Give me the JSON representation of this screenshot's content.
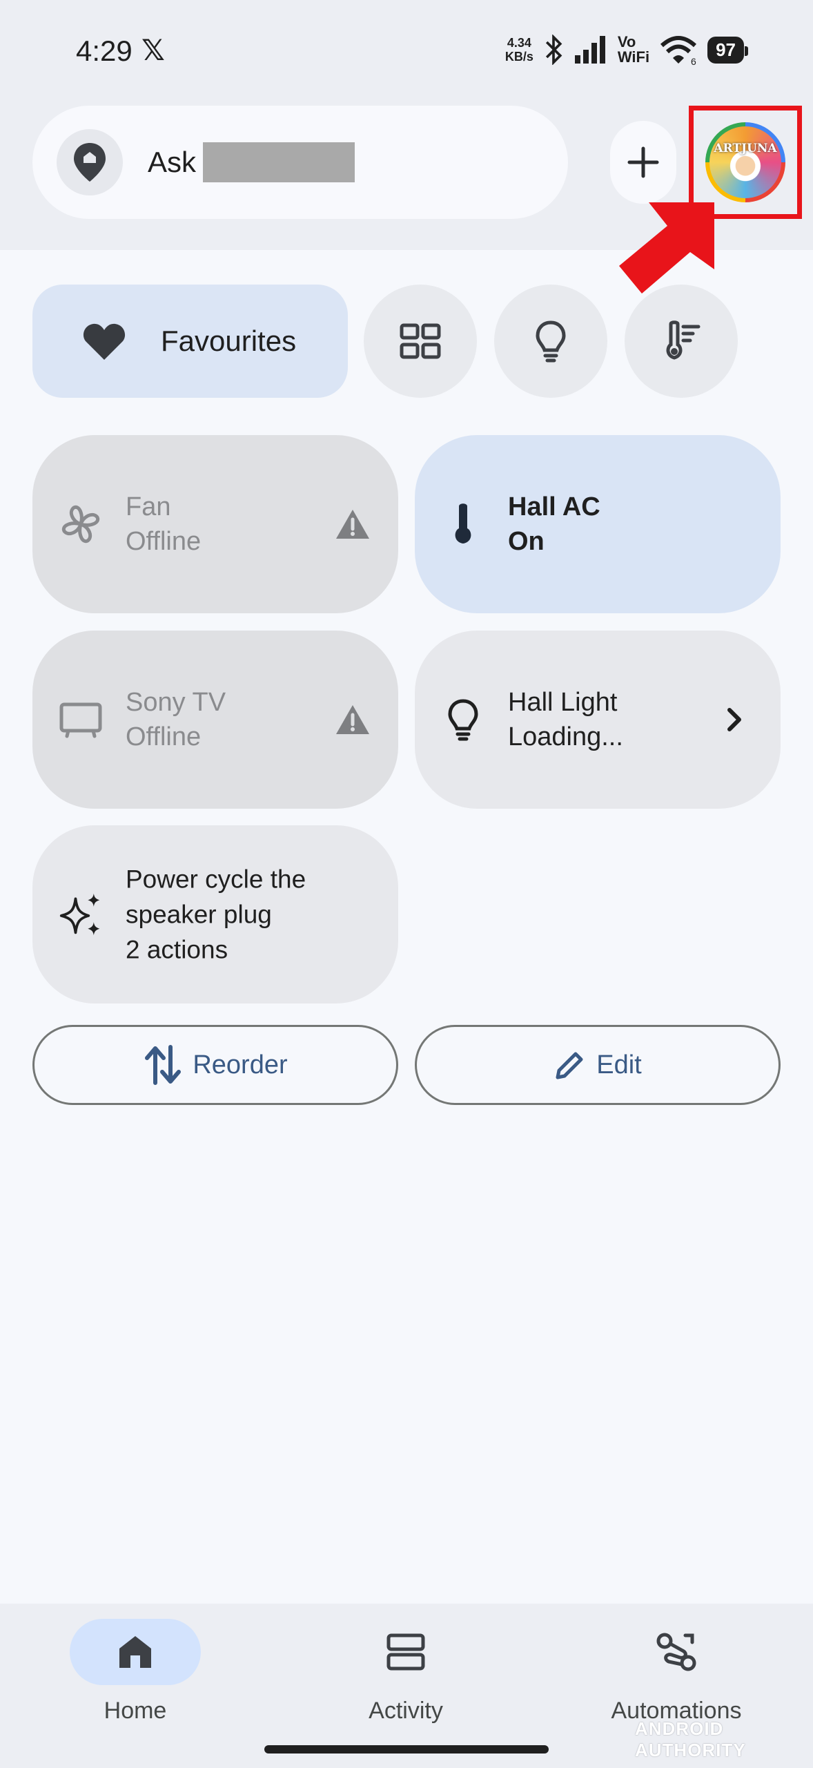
{
  "status_bar": {
    "time": "4:29",
    "x_app": "𝕏",
    "net_speed_value": "4.34",
    "net_speed_unit": "KB/s",
    "vo": "Vo",
    "wifi_label": "WiFi",
    "wifi_sub": "6",
    "battery": "97"
  },
  "search": {
    "ask_label": "Ask"
  },
  "avatar": {
    "text": "ARTJUNA"
  },
  "chips": {
    "favourites_label": "Favourites"
  },
  "devices": [
    {
      "name": "Fan",
      "status": "Offline"
    },
    {
      "name": "Hall AC",
      "status": "On"
    },
    {
      "name": "Sony TV",
      "status": "Offline"
    },
    {
      "name": "Hall Light",
      "status": "Loading..."
    }
  ],
  "automation": {
    "line1": "Power cycle the",
    "line2": "speaker plug",
    "line3": "2 actions"
  },
  "actions": {
    "reorder_label": "Reorder",
    "edit_label": "Edit"
  },
  "nav": [
    {
      "label": "Home"
    },
    {
      "label": "Activity"
    },
    {
      "label": "Automations"
    }
  ],
  "watermark": "ANDROID AUTHORITY",
  "colors": {
    "highlight_red": "#e8141a",
    "accent_blue": "#3a5a85",
    "favourites_bg": "#dbe5f5"
  }
}
